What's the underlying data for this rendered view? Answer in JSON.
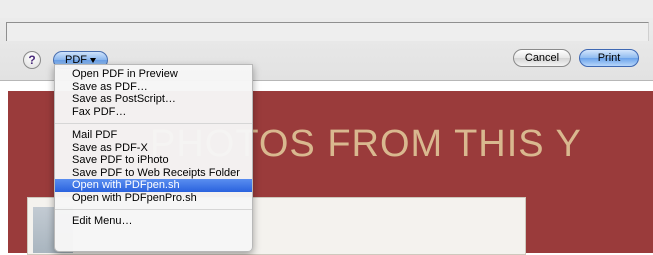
{
  "dialog": {
    "help_label": "?",
    "pdf_label": "PDF",
    "cancel_label": "Cancel",
    "print_label": "Print"
  },
  "background": {
    "banner_title": "PHOTOS FROM THIS Y"
  },
  "pdf_menu": {
    "groups": [
      [
        "Open PDF in Preview",
        "Save as PDF…",
        "Save as PostScript…",
        "Fax PDF…"
      ],
      [
        "Mail PDF",
        "Save as PDF-X",
        "Save PDF to iPhoto",
        "Save PDF to Web Receipts Folder",
        "Open with PDFpen.sh",
        "Open with PDFpenPro.sh"
      ],
      [
        "Edit Menu…"
      ]
    ],
    "highlighted": "Open with PDFpen.sh"
  },
  "colors": {
    "banner": "#9a3b3b",
    "banner_text": "#d9b88f",
    "menu_highlight": "#2a62de"
  }
}
